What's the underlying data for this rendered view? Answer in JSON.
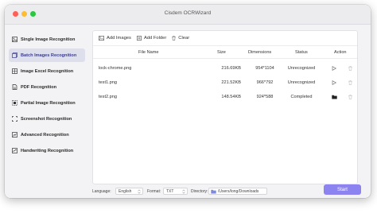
{
  "window": {
    "title": "Cisdem OCRWizard"
  },
  "sidebar": {
    "items": [
      {
        "label": "Single Image Recognition",
        "icon": "single-image-icon"
      },
      {
        "label": "Batch Images Recognition",
        "icon": "batch-images-icon",
        "active": true
      },
      {
        "label": "Image Excel Recognition",
        "icon": "image-excel-icon"
      },
      {
        "label": "PDF Recognition",
        "icon": "pdf-icon"
      },
      {
        "label": "Partial Image Recognition",
        "icon": "partial-image-icon"
      },
      {
        "label": "Screenshot Recognition",
        "icon": "screenshot-icon"
      },
      {
        "label": "Advanced Recognition",
        "icon": "advanced-icon"
      },
      {
        "label": "Handwriting Recognition",
        "icon": "handwriting-icon"
      }
    ]
  },
  "toolbar": {
    "add_images": "Add Images",
    "add_folder": "Add Folder",
    "clear": "Clear"
  },
  "table": {
    "columns": {
      "file_name": "File Name",
      "size": "Size",
      "dimensions": "Dimensions",
      "status": "Status",
      "action": "Action"
    },
    "rows": [
      {
        "name": "lock-chrome.png",
        "size": "216.69KB",
        "dimensions": "954*1104",
        "status": "Unrecognized"
      },
      {
        "name": "test1.png",
        "size": "221.52KB",
        "dimensions": "966*792",
        "status": "Unrecognized"
      },
      {
        "name": "test2.png",
        "size": "148.54KB",
        "dimensions": "924*588",
        "status": "Completed"
      }
    ]
  },
  "bottom": {
    "language_label": "Language:",
    "language_value": "English",
    "format_label": "Format:",
    "format_value": "TXT",
    "directory_label": "Directory:",
    "directory_value": "/Users/long/Downloads",
    "start": "Start"
  },
  "colors": {
    "accent": "#8c82f0",
    "sidebar_active_bg": "#dde0ec",
    "close": "#ff5f57",
    "minimize": "#febc2e",
    "zoom": "#28c840"
  }
}
